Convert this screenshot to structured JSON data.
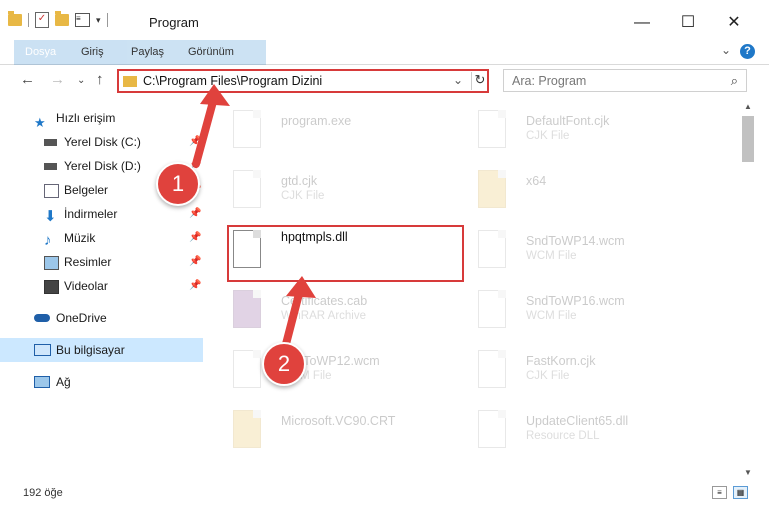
{
  "window": {
    "title": "Program",
    "minimize": "—",
    "maximize": "☐",
    "close": "✕"
  },
  "ribbon": {
    "tabs": [
      "Dosya",
      "Giriş",
      "Paylaş",
      "Görünüm"
    ],
    "help": "?"
  },
  "address": {
    "path": "C:\\Program Files\\Program Dizini",
    "search_placeholder": "Ara: Program"
  },
  "sidebar": {
    "items": [
      {
        "label": "Hızlı erişim",
        "icon": "star-icon"
      },
      {
        "label": "Yerel Disk (C:)",
        "icon": "drive-icon"
      },
      {
        "label": "Yerel Disk (D:)",
        "icon": "drive-icon"
      },
      {
        "label": "Belgeler",
        "icon": "documents-icon"
      },
      {
        "label": "İndirmeler",
        "icon": "download-icon"
      },
      {
        "label": "Müzik",
        "icon": "music-icon"
      },
      {
        "label": "Resimler",
        "icon": "pictures-icon"
      },
      {
        "label": "Videolar",
        "icon": "videos-icon"
      },
      {
        "label": "OneDrive",
        "icon": "cloud-icon"
      },
      {
        "label": "Bu bilgisayar",
        "icon": "computer-icon"
      },
      {
        "label": "Ağ",
        "icon": "network-icon"
      }
    ]
  },
  "files": [
    {
      "name": "program.exe",
      "type": ""
    },
    {
      "name": "DefaultFont.cjk",
      "type": "CJK File"
    },
    {
      "name": "gtd.cjk",
      "type": "CJK File"
    },
    {
      "name": "x64",
      "type": ""
    },
    {
      "name": "hpqtmpls.dll",
      "type": ""
    },
    {
      "name": "SndToWP14.wcm",
      "type": "WCM File"
    },
    {
      "name": "Certificates.cab",
      "type": "WinRAR Archive"
    },
    {
      "name": "SndToWP16.wcm",
      "type": "WCM File"
    },
    {
      "name": "SndToWP12.wcm",
      "type": "WCM File"
    },
    {
      "name": "FastKorn.cjk",
      "type": "CJK File"
    },
    {
      "name": "Microsoft.VC90.CRT",
      "type": ""
    },
    {
      "name": "UpdateClient65.dll",
      "type": "Resource DLL"
    }
  ],
  "status": {
    "count": "192 öğe"
  },
  "annotations": {
    "step1": "1",
    "step2": "2",
    "color": "#e0423d"
  }
}
